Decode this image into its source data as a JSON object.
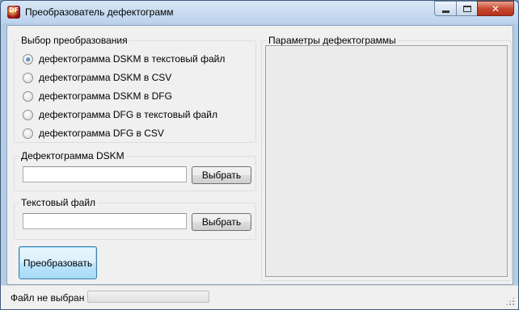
{
  "window": {
    "title": "Преобразователь дефектограмм",
    "icon": "app-icon"
  },
  "conversion_group": {
    "label": "Выбор преобразования",
    "options": [
      {
        "label": "дефектограмма DSKM в текстовый файл",
        "checked": true
      },
      {
        "label": "дефектограмма DSKM в CSV",
        "checked": false
      },
      {
        "label": "дефектограмма DSKM в DFG",
        "checked": false
      },
      {
        "label": "дефектограмма DFG в текстовый файл",
        "checked": false
      },
      {
        "label": "дефектограмма DFG в CSV",
        "checked": false
      }
    ]
  },
  "dskm_group": {
    "label": "Дефектограмма DSKM",
    "value": "",
    "browse_label": "Выбрать"
  },
  "text_group": {
    "label": "Текстовый файл",
    "value": "",
    "browse_label": "Выбрать"
  },
  "convert_button": "Преобразовать",
  "params_group": {
    "label": "Параметры дефектограммы"
  },
  "statusbar": {
    "text": "Файл не выбран",
    "progress": 0
  }
}
